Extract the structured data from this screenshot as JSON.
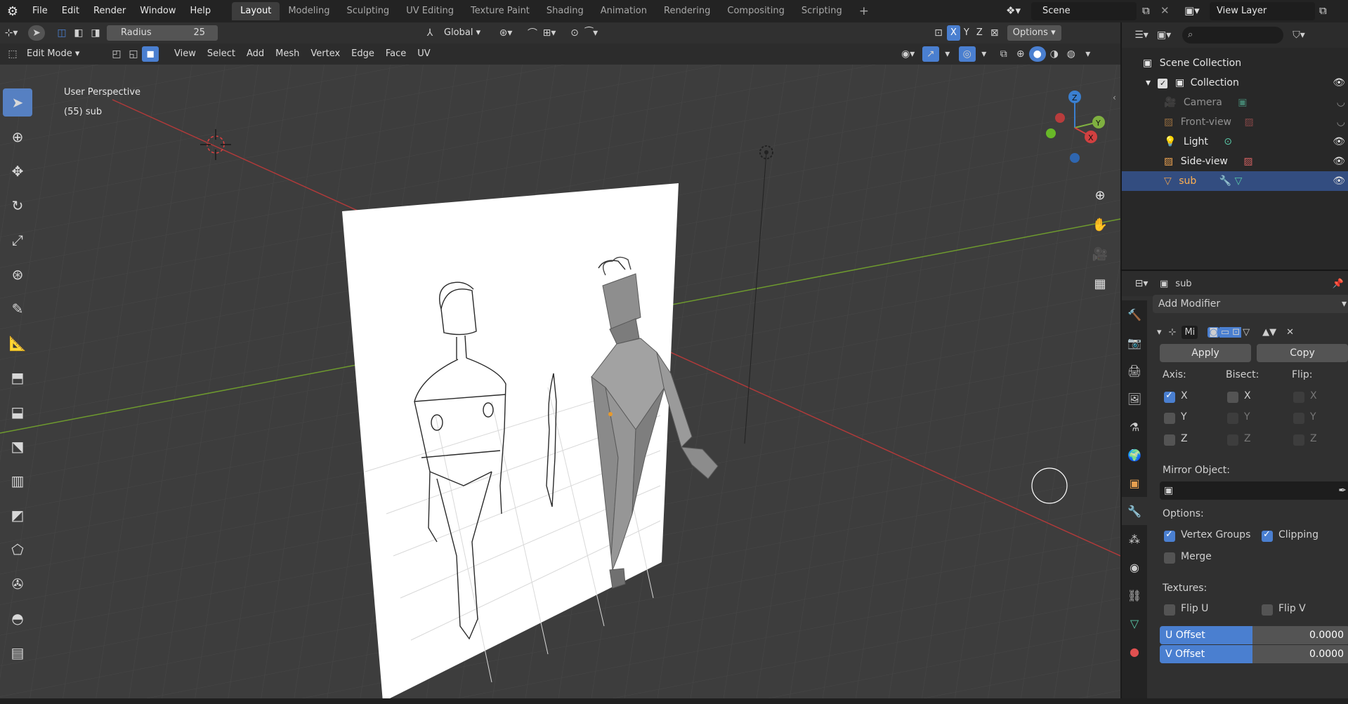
{
  "menu": [
    "File",
    "Edit",
    "Render",
    "Window",
    "Help"
  ],
  "workspaces": [
    "Layout",
    "Modeling",
    "Sculpting",
    "UV Editing",
    "Texture Paint",
    "Shading",
    "Animation",
    "Rendering",
    "Compositing",
    "Scripting",
    "+"
  ],
  "active_workspace": "Layout",
  "scene": {
    "name": "Scene",
    "view_layer": "View Layer"
  },
  "tool_header": {
    "radius_label": "Radius",
    "radius_value": "25",
    "orientation": "Global",
    "options": "Options",
    "axes": [
      "X",
      "Y",
      "Z"
    ]
  },
  "view_header": {
    "mode": "Edit Mode",
    "menus": [
      "View",
      "Select",
      "Add",
      "Mesh",
      "Vertex",
      "Edge",
      "Face",
      "UV"
    ]
  },
  "viewport": {
    "perspective": "User Perspective",
    "object_info": "(55) sub"
  },
  "gizmo": {
    "z": "Z",
    "y": "Y",
    "x": "X"
  },
  "outliner": {
    "root": "Scene Collection",
    "collection": "Collection",
    "items": [
      {
        "name": "Camera",
        "dim": true
      },
      {
        "name": "Front-view",
        "dim": true
      },
      {
        "name": "Light",
        "dim": false
      },
      {
        "name": "Side-view",
        "dim": false
      },
      {
        "name": "sub",
        "dim": false,
        "selected": true
      }
    ]
  },
  "properties": {
    "object_name": "sub",
    "add_modifier": "Add Modifier",
    "modifier_name": "Mi",
    "apply": "Apply",
    "copy": "Copy",
    "axis_label": "Axis:",
    "bisect_label": "Bisect:",
    "flip_label": "Flip:",
    "axis": [
      {
        "name": "X",
        "on": true
      },
      {
        "name": "Y",
        "on": false
      },
      {
        "name": "Z",
        "on": false
      }
    ],
    "bisect": [
      "X",
      "Y",
      "Z"
    ],
    "flip": [
      "X",
      "Y",
      "Z"
    ],
    "mirror_object_label": "Mirror Object:",
    "options_label": "Options:",
    "vertex_groups": "Vertex Groups",
    "clipping": "Clipping",
    "merge": "Merge",
    "textures_label": "Textures:",
    "flip_u": "Flip U",
    "flip_v": "Flip V",
    "u_offset_label": "U Offset",
    "u_offset": "0.0000",
    "v_offset_label": "V Offset",
    "v_offset": "0.0000"
  },
  "colors": {
    "accent": "#4a7fd0",
    "selection": "#334d80",
    "x_axis": "#b03a3a",
    "y_axis": "#6e9a2e"
  }
}
